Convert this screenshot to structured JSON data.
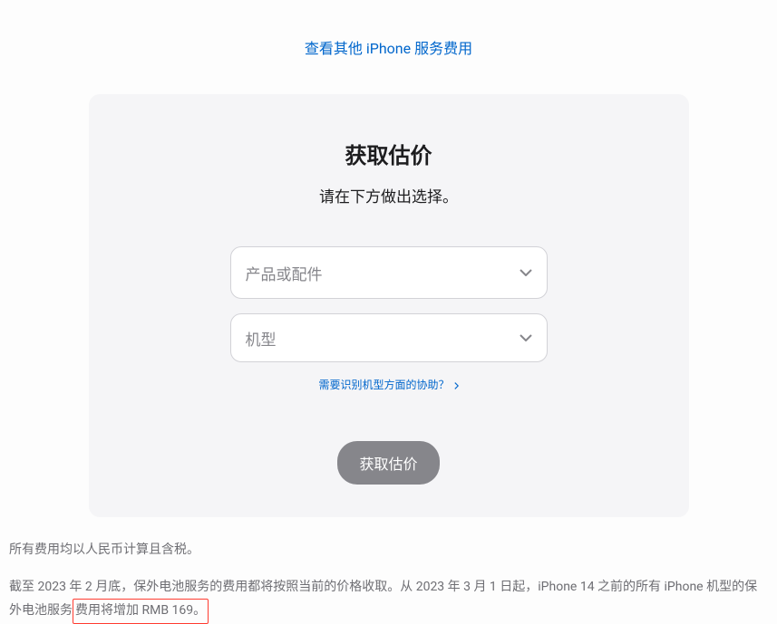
{
  "topLink": "查看其他 iPhone 服务费用",
  "card": {
    "title": "获取估价",
    "subtitle": "请在下方做出选择。",
    "select1": {
      "placeholder": "产品或配件"
    },
    "select2": {
      "placeholder": "机型"
    },
    "helpLink": "需要识别机型方面的协助？",
    "submitButton": "获取估价"
  },
  "footer": {
    "line1": "所有费用均以人民币计算且含税。",
    "line2_part1": "截至 2023 年 2 月底，保外电池服务的费用都将按照当前的价格收取。从 2023 年 3 月 1 日起，iPhone 14 之前的所有 iPhone 机型的保外电池服务",
    "line2_highlight": "费用将增加 RMB 169。"
  }
}
